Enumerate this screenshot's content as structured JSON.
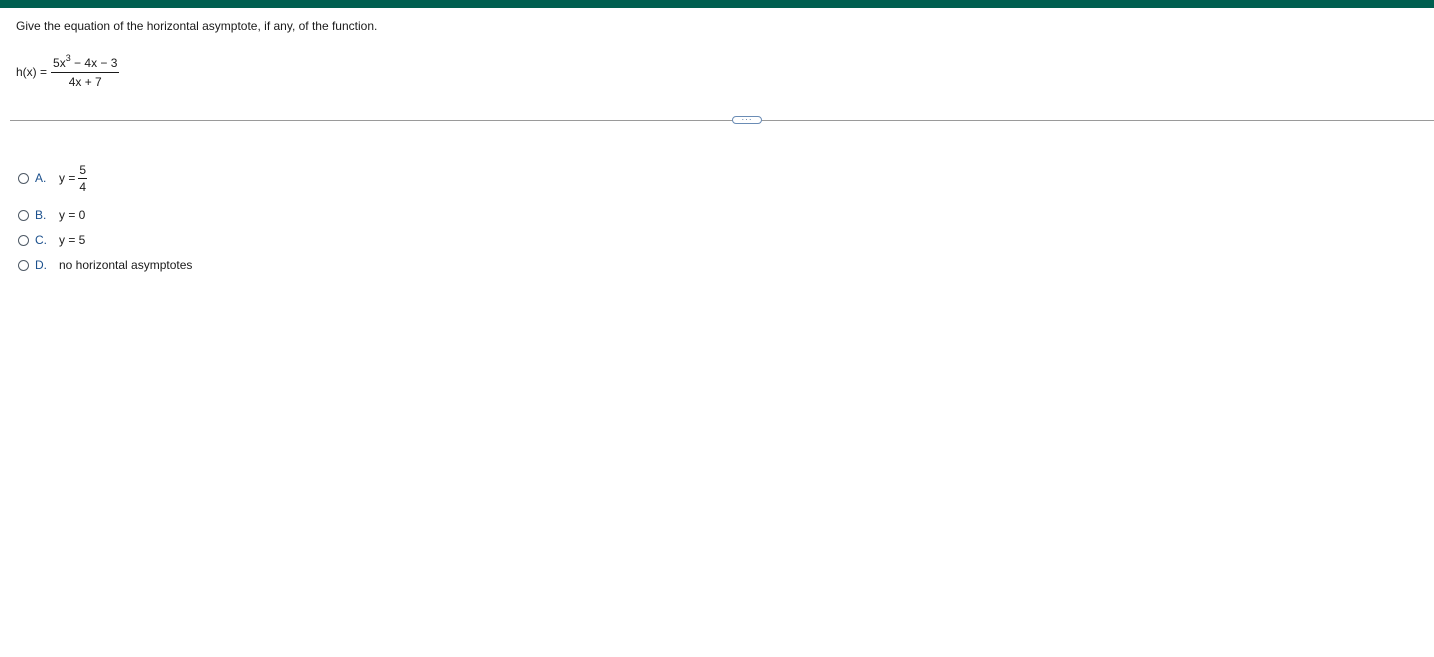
{
  "question": {
    "prompt": "Give the equation of the horizontal asymptote, if any, of the function."
  },
  "equation": {
    "lhs": "h(x) =",
    "numerator_base": "5x",
    "numerator_exponent": "3",
    "numerator_rest": " − 4x − 3",
    "denominator": "4x + 7"
  },
  "more_button": {
    "label": "···"
  },
  "choices": [
    {
      "letter": "A.",
      "prefix": "y =",
      "frac_num": "5",
      "frac_den": "4"
    },
    {
      "letter": "B.",
      "text": "y = 0"
    },
    {
      "letter": "C.",
      "text": "y = 5"
    },
    {
      "letter": "D.",
      "text": "no horizontal asymptotes"
    }
  ],
  "colors": {
    "top_bar": "#005f50",
    "choice_letter": "#1a4f8c",
    "divider": "#9a9a9a"
  }
}
